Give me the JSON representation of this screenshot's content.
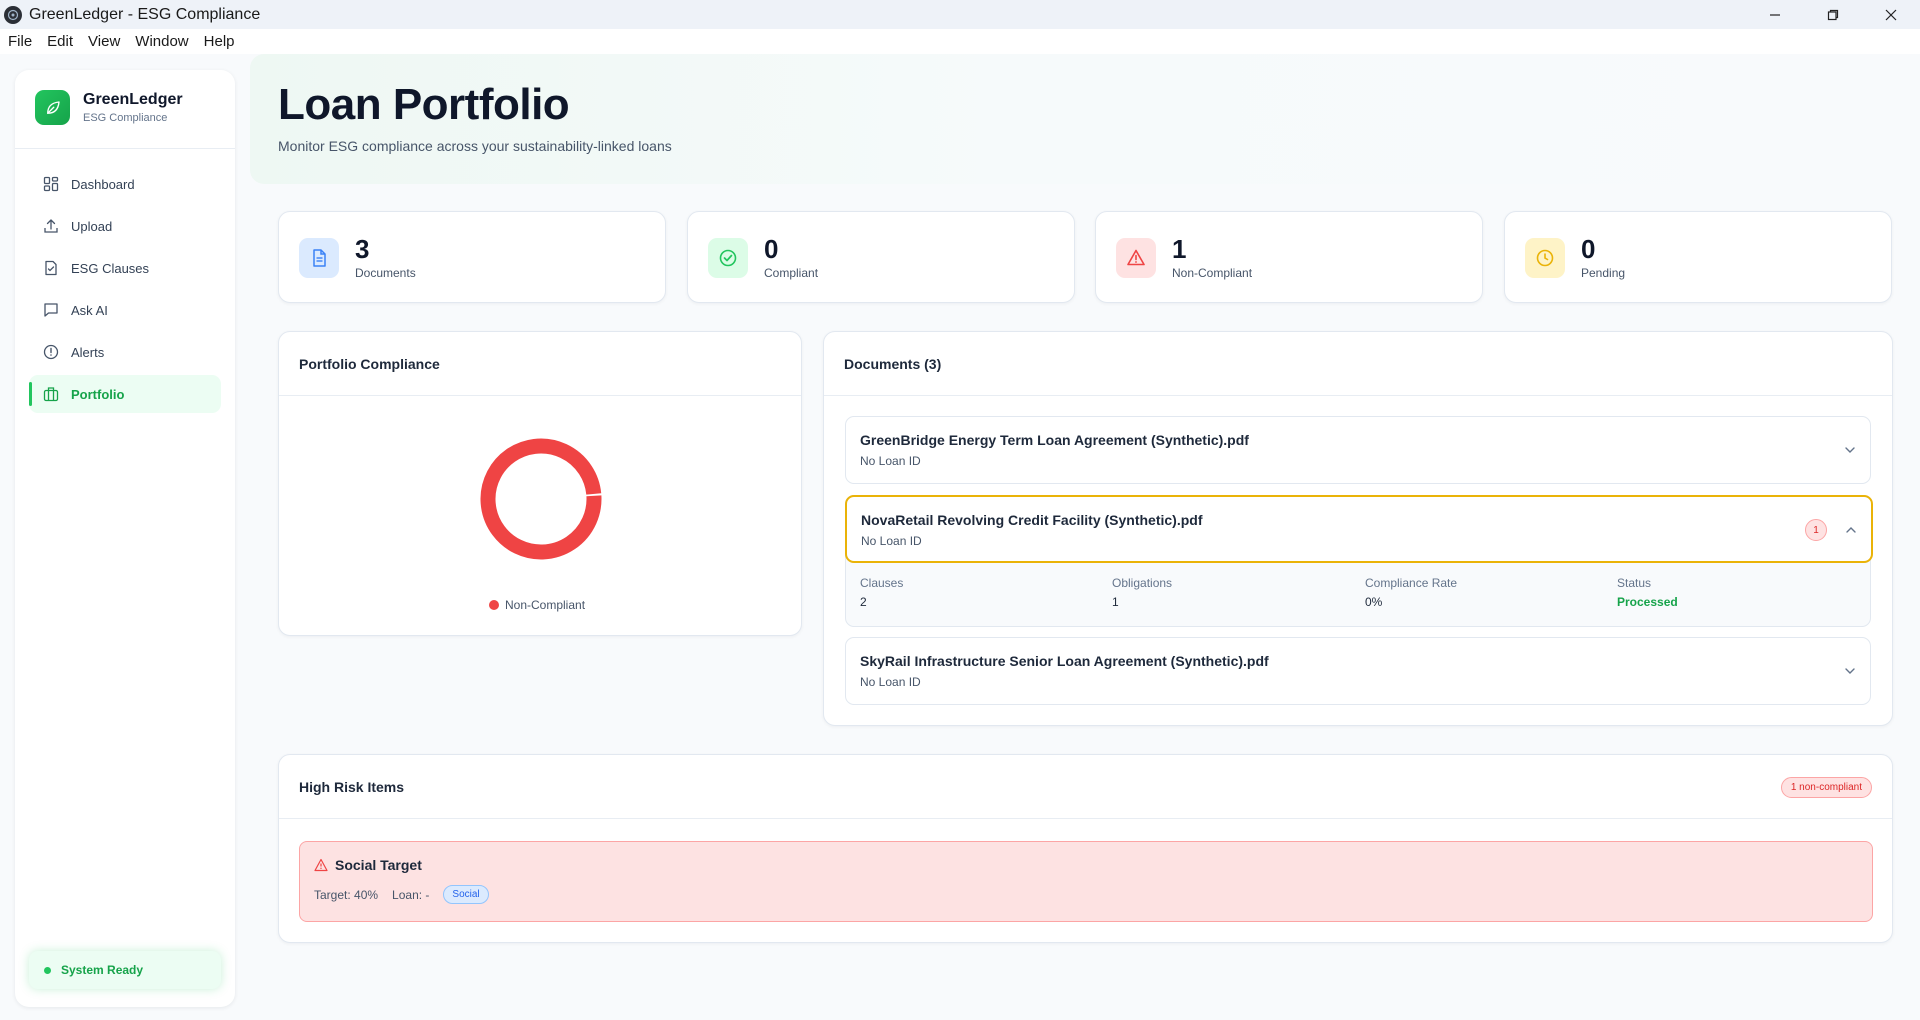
{
  "window": {
    "title": "GreenLedger - ESG Compliance"
  },
  "menu": [
    "File",
    "Edit",
    "View",
    "Window",
    "Help"
  ],
  "brand": {
    "name": "GreenLedger",
    "subtitle": "ESG Compliance"
  },
  "nav": [
    {
      "label": "Dashboard",
      "icon": "dashboard-icon"
    },
    {
      "label": "Upload",
      "icon": "upload-icon"
    },
    {
      "label": "ESG Clauses",
      "icon": "document-icon"
    },
    {
      "label": "Ask AI",
      "icon": "chat-icon"
    },
    {
      "label": "Alerts",
      "icon": "alert-icon"
    },
    {
      "label": "Portfolio",
      "icon": "briefcase-icon",
      "active": true
    }
  ],
  "system_status": "System Ready",
  "header": {
    "title": "Loan Portfolio",
    "subtitle": "Monitor ESG compliance across your sustainability-linked loans"
  },
  "stats": [
    {
      "value": "3",
      "label": "Documents",
      "color": "#3b82f6"
    },
    {
      "value": "0",
      "label": "Compliant",
      "color": "#22c55e"
    },
    {
      "value": "1",
      "label": "Non-Compliant",
      "color": "#ef4444"
    },
    {
      "value": "0",
      "label": "Pending",
      "color": "#eab308"
    }
  ],
  "compliance_panel": {
    "title": "Portfolio Compliance",
    "legend": "Non-Compliant"
  },
  "chart_data": {
    "type": "pie",
    "categories": [
      "Non-Compliant"
    ],
    "values": [
      1
    ],
    "colors": [
      "#ef4444"
    ]
  },
  "documents_panel": {
    "title": "Documents (3)",
    "items": [
      {
        "name": "GreenBridge Energy Term Loan Agreement (Synthetic).pdf",
        "loan_id": "No Loan ID"
      },
      {
        "name": "NovaRetail Revolving Credit Facility (Synthetic).pdf",
        "loan_id": "No Loan ID",
        "badge": "1",
        "clauses_label": "Clauses",
        "clauses": "2",
        "obligations_label": "Obligations",
        "obligations": "1",
        "rate_label": "Compliance Rate",
        "rate": "0%",
        "status_label": "Status",
        "status": "Processed"
      },
      {
        "name": "SkyRail Infrastructure Senior Loan Agreement (Synthetic).pdf",
        "loan_id": "No Loan ID"
      }
    ]
  },
  "high_risk": {
    "title": "High Risk Items",
    "badge": "1 non-compliant",
    "items": [
      {
        "title": "Social Target",
        "target": "Target: 40%",
        "loan": "Loan: -",
        "tag": "Social"
      }
    ]
  },
  "colors": {
    "accent": "#22c55e",
    "danger": "#ef4444",
    "warning": "#eab308",
    "info": "#3b82f6"
  }
}
